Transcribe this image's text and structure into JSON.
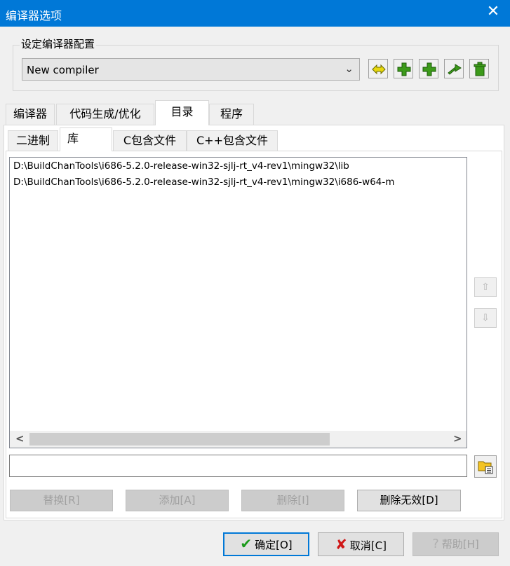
{
  "window": {
    "title": "编译器选项",
    "close_icon": "close-icon"
  },
  "compiler_set": {
    "group_label": "设定编译器配置",
    "selected": "New compiler",
    "toolbar_icons": [
      "rename-icon",
      "add-icon",
      "add-icon",
      "arrow-icon",
      "trash-icon"
    ]
  },
  "tabs": [
    "编译器",
    "代码生成/优化",
    "目录",
    "程序"
  ],
  "active_tab": "目录",
  "subtabs": [
    "二进制",
    "库",
    "C包含文件",
    "C++包含文件"
  ],
  "active_subtab": "库",
  "directories": [
    "D:\\BuildChanTools\\i686-5.2.0-release-win32-sjlj-rt_v4-rev1\\mingw32\\lib",
    "D:\\BuildChanTools\\i686-5.2.0-release-win32-sjlj-rt_v4-rev1\\mingw32\\i686-w64-m"
  ],
  "scroll": {
    "left": "<",
    "right": ">"
  },
  "path_input": {
    "value": ""
  },
  "actions": {
    "replace": "替换[R]",
    "add": "添加[A]",
    "delete": "删除[I]",
    "delete_invalid": "删除无效[D]"
  },
  "footer": {
    "ok": "确定[O]",
    "cancel": "取消[C]",
    "help": "帮助[H]"
  },
  "colors": {
    "titlebar": "#0078d7",
    "ok_check": "#1a9a1a",
    "cancel_x": "#d01818",
    "toolbar_icon": "#3c9a1a"
  }
}
